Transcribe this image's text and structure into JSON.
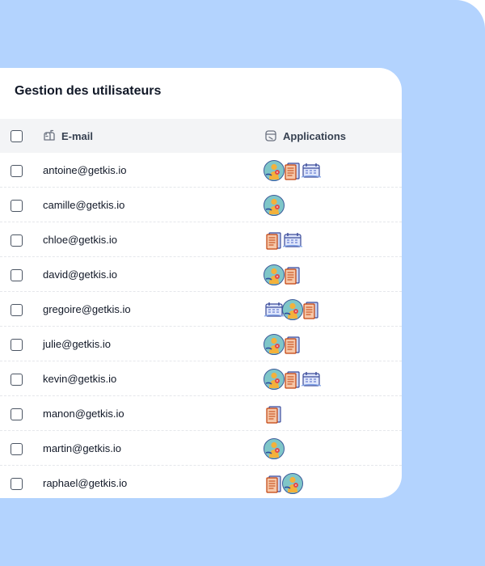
{
  "title": "Gestion des utilisateurs",
  "columns": {
    "email": "E-mail",
    "applications": "Applications"
  },
  "icons": {
    "email_header": "mailbox-icon",
    "apps_header": "app-window-icon",
    "app_types": [
      "person-app-icon",
      "document-app-icon",
      "calendar-app-icon"
    ]
  },
  "colors": {
    "background": "#b3d3fe",
    "header": "#f3f4f6",
    "text": "#111827"
  },
  "users": [
    {
      "email": "antoine@getkis.io",
      "apps": [
        "person",
        "document",
        "calendar"
      ]
    },
    {
      "email": "camille@getkis.io",
      "apps": [
        "person"
      ]
    },
    {
      "email": "chloe@getkis.io",
      "apps": [
        "document",
        "calendar"
      ]
    },
    {
      "email": "david@getkis.io",
      "apps": [
        "person",
        "document"
      ]
    },
    {
      "email": "gregoire@getkis.io",
      "apps": [
        "calendar",
        "person",
        "document"
      ]
    },
    {
      "email": "julie@getkis.io",
      "apps": [
        "person",
        "document"
      ]
    },
    {
      "email": "kevin@getkis.io",
      "apps": [
        "person",
        "document",
        "calendar"
      ]
    },
    {
      "email": "manon@getkis.io",
      "apps": [
        "document"
      ]
    },
    {
      "email": "martin@getkis.io",
      "apps": [
        "person"
      ]
    },
    {
      "email": "raphael@getkis.io",
      "apps": [
        "document",
        "person"
      ]
    }
  ]
}
